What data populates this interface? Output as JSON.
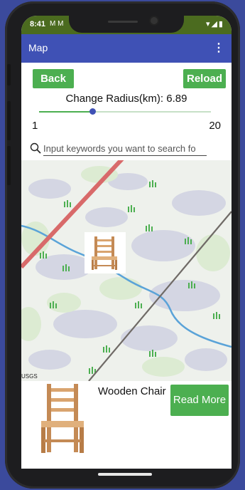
{
  "status_bar": {
    "time": "8:41",
    "notifications": "M M",
    "right_icons": "▾◢▮"
  },
  "app_bar": {
    "title": "Map",
    "menu_icon": "⋮"
  },
  "controls": {
    "back_label": "Back",
    "reload_label": "Reload",
    "radius_label": "Change Radius(km): 6.89",
    "slider": {
      "min": "1",
      "max": "20",
      "value": 6.89
    }
  },
  "search": {
    "placeholder": "Input keywords you want to search fo",
    "value": ""
  },
  "map": {
    "attribution": "USGS"
  },
  "marker": {
    "icon": "chair-thumbnail"
  },
  "info_card": {
    "title": "Wooden Chair",
    "read_more_label": "Read More"
  },
  "colors": {
    "accent": "#4caf50",
    "app_bar": "#3f51b5",
    "status_bar": "#4b6b1f"
  }
}
